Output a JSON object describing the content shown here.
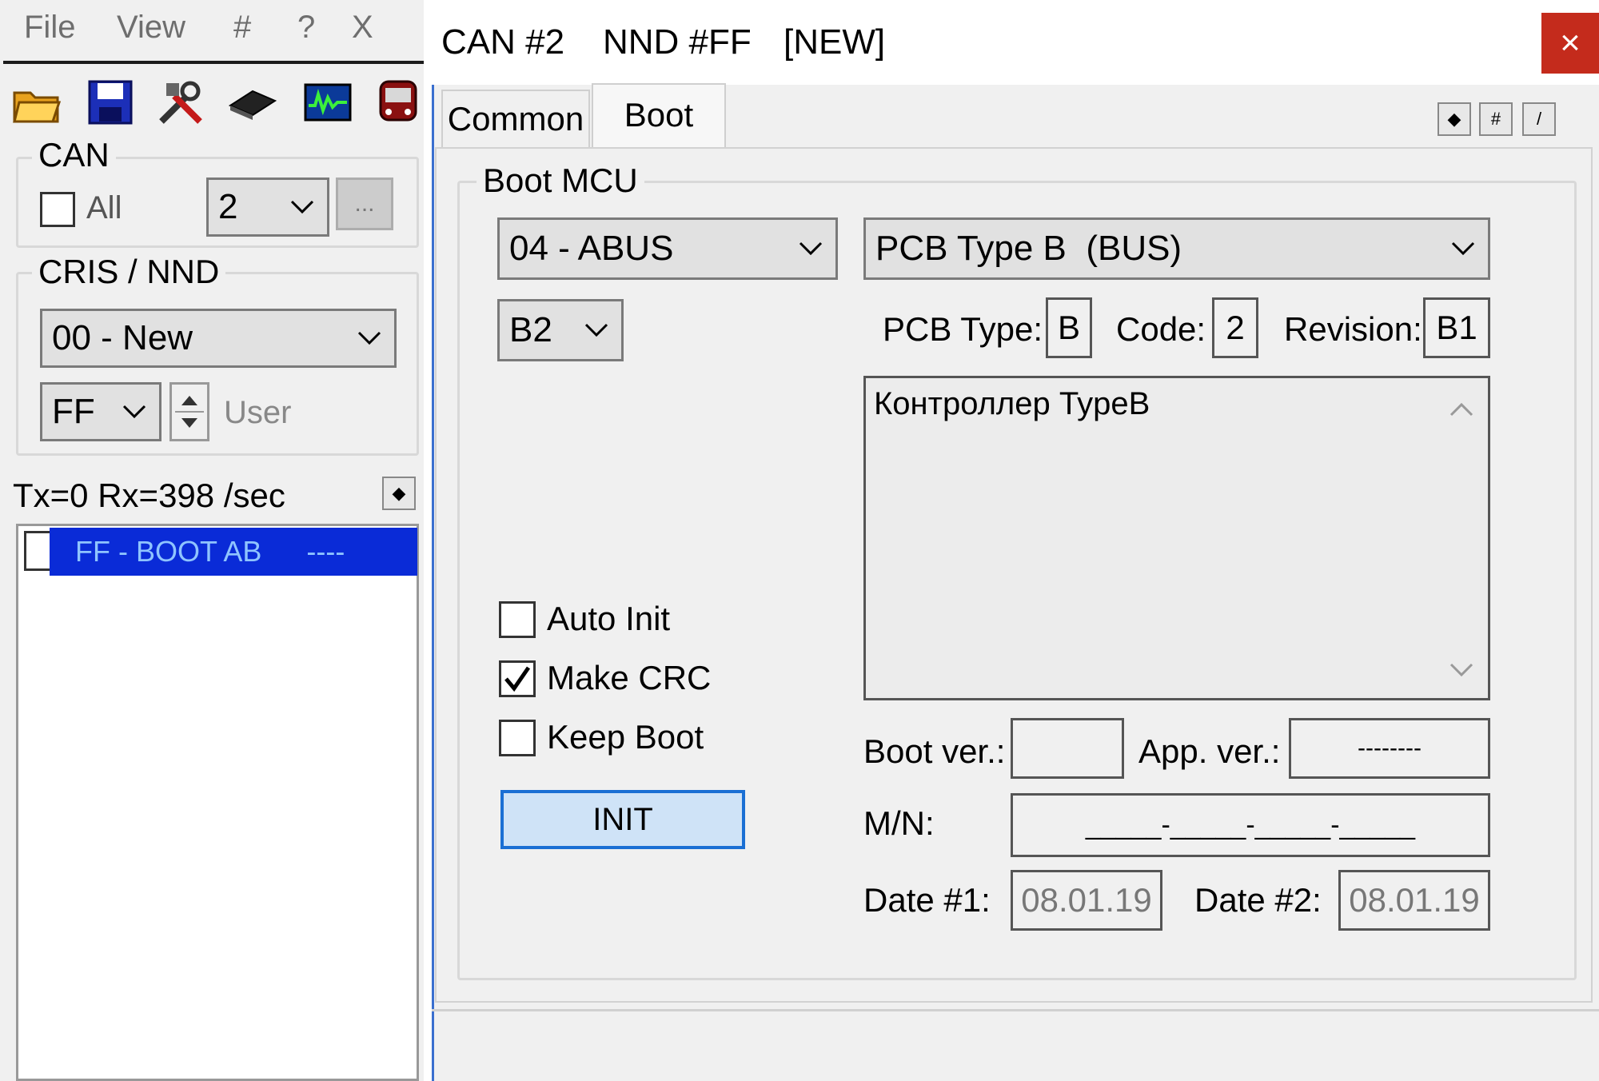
{
  "menu": {
    "file": "File",
    "view": "View",
    "hash": "#",
    "help": "?",
    "exit": "X"
  },
  "toolbar": {
    "icons": [
      "open-folder-icon",
      "save-disk-icon",
      "tools-icon",
      "chip-icon",
      "oscilloscope-icon",
      "bus-icon"
    ]
  },
  "can_group": {
    "title": "CAN",
    "all_label": "All",
    "channel_value": "2",
    "browse_label": "..."
  },
  "cris_group": {
    "title": "CRIS / NND",
    "device_value": "00 - New",
    "node_value": "FF",
    "user_label": "User"
  },
  "stats": {
    "text": "Tx=0 Rx=398 /sec"
  },
  "node_list": {
    "items": [
      {
        "label": "FF - BOOT AB",
        "status": "----"
      }
    ]
  },
  "dialog": {
    "title_can": "CAN #2",
    "title_nnd": "NND #FF",
    "title_state": "[NEW]",
    "close_label": "×",
    "tabs": [
      {
        "label": "Common"
      },
      {
        "label": "Boot"
      }
    ],
    "tool_buttons": [
      "◆",
      "#",
      "/"
    ]
  },
  "boot": {
    "group_title": "Boot MCU",
    "mcu_value": "04 - ABUS",
    "pcb_value": "PCB Type B  (BUS)",
    "rev_select_value": "B2",
    "pcb_type_label": "PCB Type:",
    "pcb_type_value": "B",
    "code_label": "Code:",
    "code_value": "2",
    "revision_label": "Revision:",
    "revision_value": "B1",
    "description": "Контроллер TypeB",
    "auto_init_label": "Auto Init",
    "make_crc_label": "Make CRC",
    "keep_boot_label": "Keep Boot",
    "init_label": "INIT",
    "boot_ver_label": "Boot ver.:",
    "boot_ver_value": "",
    "app_ver_label": "App. ver.:",
    "app_ver_value": "--------",
    "mn_label": "M/N:",
    "mn_value": "_____-_____-_____-_____",
    "date1_label": "Date #1:",
    "date1_value": "08.01.19",
    "date2_label": "Date #2:",
    "date2_value": "08.01.19"
  },
  "checks": {
    "auto_init": false,
    "make_crc": true,
    "keep_boot": false,
    "can_all": false
  }
}
